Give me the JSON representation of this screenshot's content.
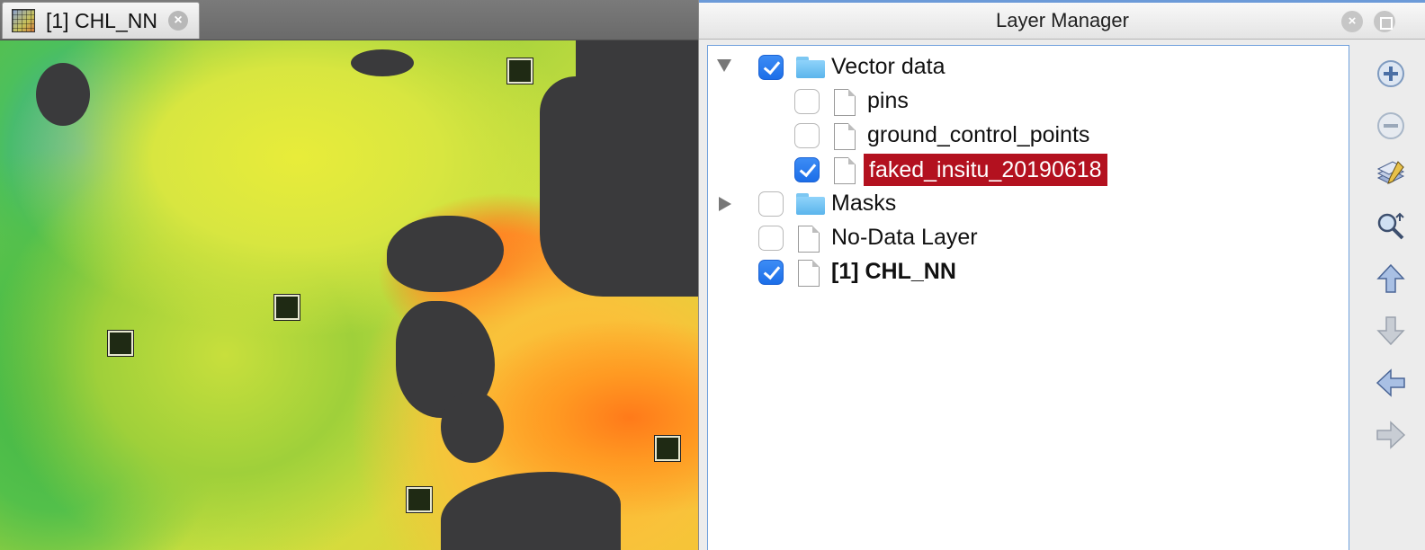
{
  "image_view": {
    "tab_title": "[1] CHL_NN"
  },
  "layer_manager": {
    "title": "Layer Manager",
    "tree": [
      {
        "label": "Vector data",
        "checked": true,
        "kind": "folder",
        "expanded": true,
        "level": 0
      },
      {
        "label": "pins",
        "checked": false,
        "kind": "layer",
        "level": 1
      },
      {
        "label": "ground_control_points",
        "checked": false,
        "kind": "layer",
        "level": 1
      },
      {
        "label": "faked_insitu_20190618",
        "checked": true,
        "kind": "layer",
        "level": 1,
        "selected": true
      },
      {
        "label": "Masks",
        "checked": false,
        "kind": "folder",
        "expanded": false,
        "level": 0
      },
      {
        "label": "No-Data Layer",
        "checked": false,
        "kind": "layer",
        "level": 0
      },
      {
        "label": "[1] CHL_NN",
        "checked": true,
        "kind": "layer",
        "level": 0,
        "bold": true
      }
    ],
    "toolbar": [
      {
        "name": "add-layer",
        "icon": "plus-circle-icon",
        "enabled": true
      },
      {
        "name": "remove-layer",
        "icon": "minus-circle-icon",
        "enabled": false
      },
      {
        "name": "open-layer-editor",
        "icon": "layer-edit-icon",
        "enabled": true
      },
      {
        "name": "zoom-to-layer",
        "icon": "zoom-to-layer-icon",
        "enabled": true
      },
      {
        "name": "move-layer-up",
        "icon": "arrow-up-icon",
        "enabled": true
      },
      {
        "name": "move-layer-down",
        "icon": "arrow-down-icon",
        "enabled": false
      },
      {
        "name": "move-layer-left",
        "icon": "arrow-left-icon",
        "enabled": true
      },
      {
        "name": "move-layer-right",
        "icon": "arrow-right-icon",
        "enabled": false
      }
    ]
  },
  "colors": {
    "selection": "#b3111f",
    "checkbox_on": "#1c6ee8",
    "land": "#3a3a3c"
  }
}
